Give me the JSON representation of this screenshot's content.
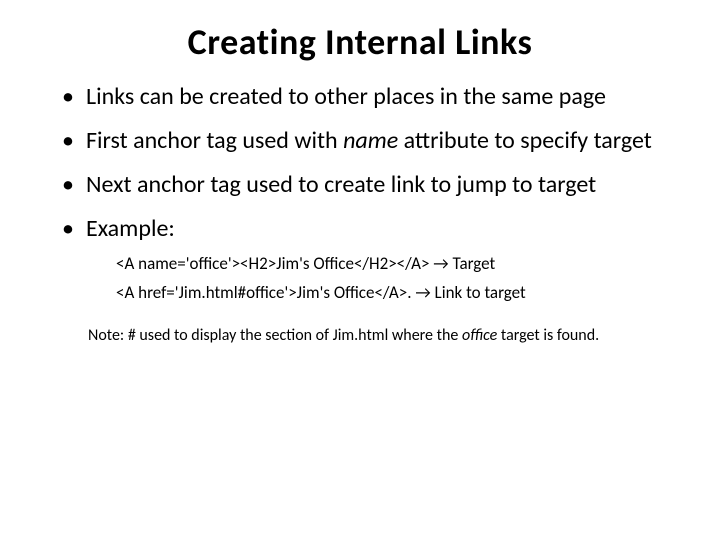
{
  "title": "Creating Internal Links",
  "bullets": {
    "b1": "Links can be created to other places in the same page",
    "b2_pre": "First anchor tag used with ",
    "b2_italic": "name",
    "b2_post": " attribute to specify target",
    "b3": "Next anchor tag used to create link to jump to target",
    "b4": "Example:"
  },
  "example": {
    "line1_code": "<A name='office'><H2>Jim's Office</H2></A>  →  Target",
    "line2_code": "<A href='Jim.html#office'>Jim's Office</A>.  →  Link to target"
  },
  "note": {
    "pre": "Note: # used to display the section of Jim.html where the ",
    "italic": "office",
    "post": " target is found."
  }
}
